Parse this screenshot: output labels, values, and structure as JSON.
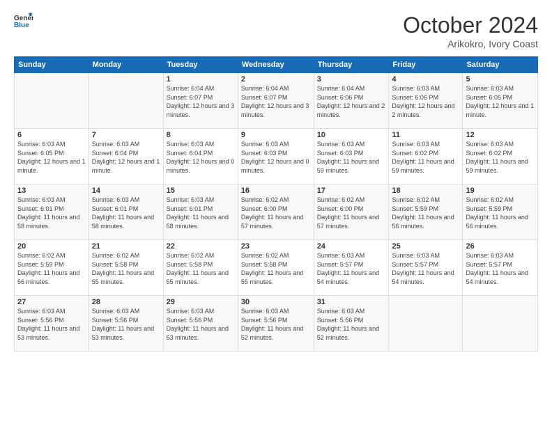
{
  "logo": {
    "line1": "General",
    "line2": "Blue"
  },
  "title": "October 2024",
  "subtitle": "Arikokro, Ivory Coast",
  "days_of_week": [
    "Sunday",
    "Monday",
    "Tuesday",
    "Wednesday",
    "Thursday",
    "Friday",
    "Saturday"
  ],
  "weeks": [
    [
      {
        "num": "",
        "info": ""
      },
      {
        "num": "",
        "info": ""
      },
      {
        "num": "1",
        "info": "Sunrise: 6:04 AM\nSunset: 6:07 PM\nDaylight: 12 hours and 3 minutes."
      },
      {
        "num": "2",
        "info": "Sunrise: 6:04 AM\nSunset: 6:07 PM\nDaylight: 12 hours and 3 minutes."
      },
      {
        "num": "3",
        "info": "Sunrise: 6:04 AM\nSunset: 6:06 PM\nDaylight: 12 hours and 2 minutes."
      },
      {
        "num": "4",
        "info": "Sunrise: 6:03 AM\nSunset: 6:06 PM\nDaylight: 12 hours and 2 minutes."
      },
      {
        "num": "5",
        "info": "Sunrise: 6:03 AM\nSunset: 6:05 PM\nDaylight: 12 hours and 1 minute."
      }
    ],
    [
      {
        "num": "6",
        "info": "Sunrise: 6:03 AM\nSunset: 6:05 PM\nDaylight: 12 hours and 1 minute."
      },
      {
        "num": "7",
        "info": "Sunrise: 6:03 AM\nSunset: 6:04 PM\nDaylight: 12 hours and 1 minute."
      },
      {
        "num": "8",
        "info": "Sunrise: 6:03 AM\nSunset: 6:04 PM\nDaylight: 12 hours and 0 minutes."
      },
      {
        "num": "9",
        "info": "Sunrise: 6:03 AM\nSunset: 6:03 PM\nDaylight: 12 hours and 0 minutes."
      },
      {
        "num": "10",
        "info": "Sunrise: 6:03 AM\nSunset: 6:03 PM\nDaylight: 11 hours and 59 minutes."
      },
      {
        "num": "11",
        "info": "Sunrise: 6:03 AM\nSunset: 6:02 PM\nDaylight: 11 hours and 59 minutes."
      },
      {
        "num": "12",
        "info": "Sunrise: 6:03 AM\nSunset: 6:02 PM\nDaylight: 11 hours and 59 minutes."
      }
    ],
    [
      {
        "num": "13",
        "info": "Sunrise: 6:03 AM\nSunset: 6:01 PM\nDaylight: 11 hours and 58 minutes."
      },
      {
        "num": "14",
        "info": "Sunrise: 6:03 AM\nSunset: 6:01 PM\nDaylight: 11 hours and 58 minutes."
      },
      {
        "num": "15",
        "info": "Sunrise: 6:03 AM\nSunset: 6:01 PM\nDaylight: 11 hours and 58 minutes."
      },
      {
        "num": "16",
        "info": "Sunrise: 6:02 AM\nSunset: 6:00 PM\nDaylight: 11 hours and 57 minutes."
      },
      {
        "num": "17",
        "info": "Sunrise: 6:02 AM\nSunset: 6:00 PM\nDaylight: 11 hours and 57 minutes."
      },
      {
        "num": "18",
        "info": "Sunrise: 6:02 AM\nSunset: 5:59 PM\nDaylight: 11 hours and 56 minutes."
      },
      {
        "num": "19",
        "info": "Sunrise: 6:02 AM\nSunset: 5:59 PM\nDaylight: 11 hours and 56 minutes."
      }
    ],
    [
      {
        "num": "20",
        "info": "Sunrise: 6:02 AM\nSunset: 5:59 PM\nDaylight: 11 hours and 56 minutes."
      },
      {
        "num": "21",
        "info": "Sunrise: 6:02 AM\nSunset: 5:58 PM\nDaylight: 11 hours and 55 minutes."
      },
      {
        "num": "22",
        "info": "Sunrise: 6:02 AM\nSunset: 5:58 PM\nDaylight: 11 hours and 55 minutes."
      },
      {
        "num": "23",
        "info": "Sunrise: 6:02 AM\nSunset: 5:58 PM\nDaylight: 11 hours and 55 minutes."
      },
      {
        "num": "24",
        "info": "Sunrise: 6:03 AM\nSunset: 5:57 PM\nDaylight: 11 hours and 54 minutes."
      },
      {
        "num": "25",
        "info": "Sunrise: 6:03 AM\nSunset: 5:57 PM\nDaylight: 11 hours and 54 minutes."
      },
      {
        "num": "26",
        "info": "Sunrise: 6:03 AM\nSunset: 5:57 PM\nDaylight: 11 hours and 54 minutes."
      }
    ],
    [
      {
        "num": "27",
        "info": "Sunrise: 6:03 AM\nSunset: 5:56 PM\nDaylight: 11 hours and 53 minutes."
      },
      {
        "num": "28",
        "info": "Sunrise: 6:03 AM\nSunset: 5:56 PM\nDaylight: 11 hours and 53 minutes."
      },
      {
        "num": "29",
        "info": "Sunrise: 6:03 AM\nSunset: 5:56 PM\nDaylight: 11 hours and 53 minutes."
      },
      {
        "num": "30",
        "info": "Sunrise: 6:03 AM\nSunset: 5:56 PM\nDaylight: 11 hours and 52 minutes."
      },
      {
        "num": "31",
        "info": "Sunrise: 6:03 AM\nSunset: 5:56 PM\nDaylight: 11 hours and 52 minutes."
      },
      {
        "num": "",
        "info": ""
      },
      {
        "num": "",
        "info": ""
      }
    ]
  ]
}
